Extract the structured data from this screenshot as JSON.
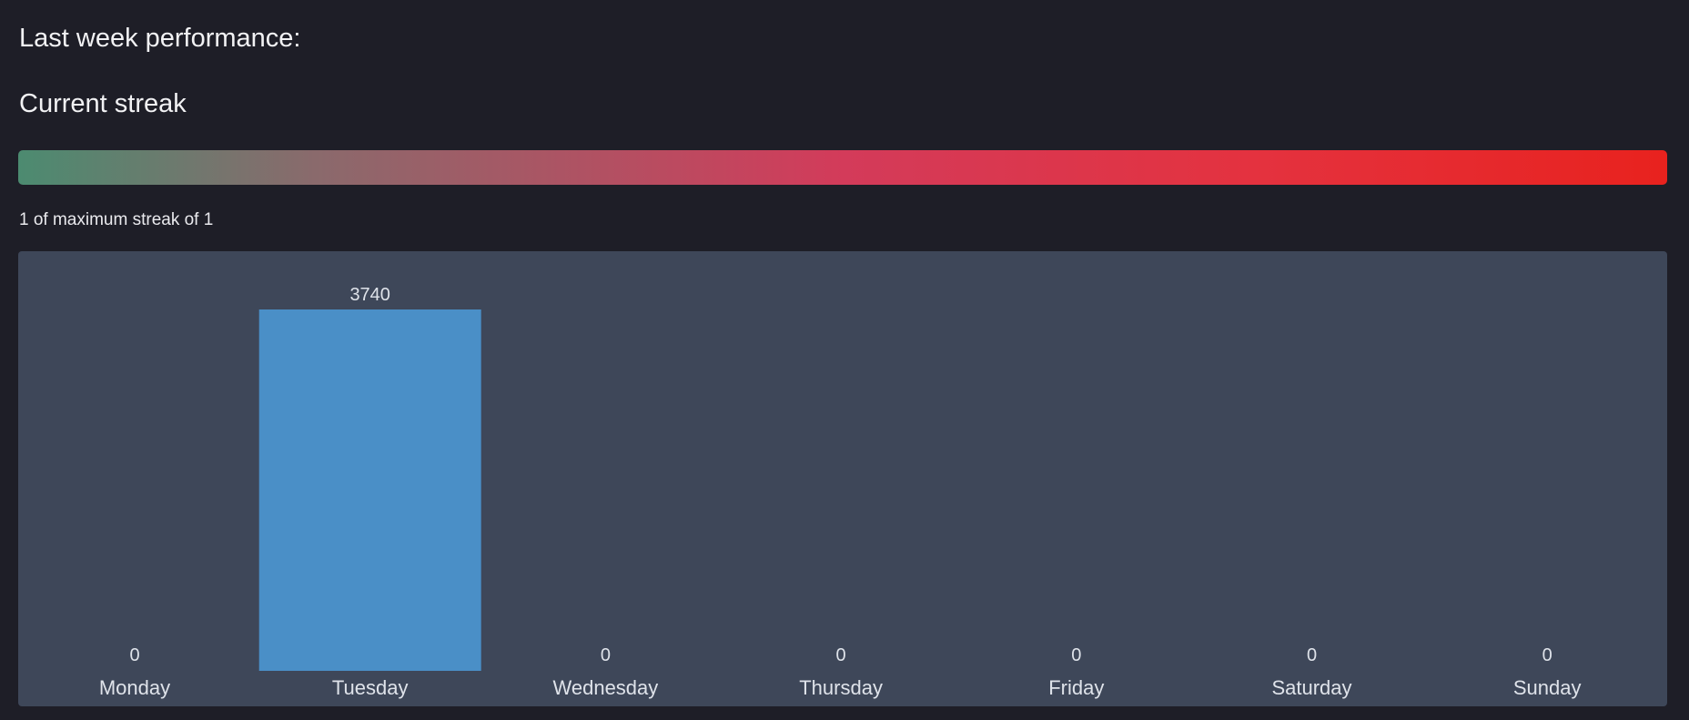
{
  "header": {
    "title": "Last week performance:",
    "streak_title": "Current streak"
  },
  "streak": {
    "current": 1,
    "maximum": 1,
    "text": "1 of maximum streak of 1",
    "gradient_colors": [
      "#4c8b70",
      "#d33b5a",
      "#e8221e"
    ]
  },
  "colors": {
    "background": "#1e1e27",
    "panel": "#3e4759",
    "bar": "#4a8fc7",
    "label": "#dfe3ea"
  },
  "chart_data": {
    "type": "bar",
    "categories": [
      "Monday",
      "Tuesday",
      "Wednesday",
      "Thursday",
      "Friday",
      "Saturday",
      "Sunday"
    ],
    "values": [
      0,
      3740,
      0,
      0,
      0,
      0,
      0
    ],
    "value_labels": [
      "0",
      "3740",
      "0",
      "0",
      "0",
      "0",
      "0"
    ],
    "ylim": [
      0,
      3740
    ],
    "grid": false,
    "legend": "none"
  }
}
